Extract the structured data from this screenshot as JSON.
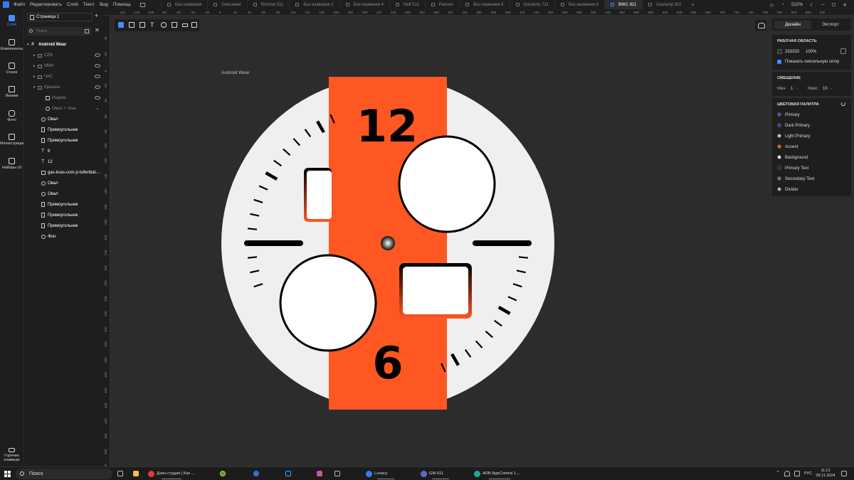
{
  "app": {
    "menu": [
      "Файл",
      "Редактировать",
      "Слой",
      "Текст",
      "Вид",
      "Помощь"
    ],
    "tabs": [
      {
        "label": "Без названия",
        "active": false
      },
      {
        "label": "Описание",
        "active": false
      },
      {
        "label": "Rimmel 311",
        "active": false
      },
      {
        "label": "Без названия 2",
        "active": false
      },
      {
        "label": "Без названия 4",
        "active": false
      },
      {
        "label": "Half 511",
        "active": false
      },
      {
        "label": "Pannex",
        "active": false
      },
      {
        "label": "Без названия 5",
        "active": false
      },
      {
        "label": "Gaslamp 711",
        "active": false
      },
      {
        "label": "Без названия 6",
        "active": false
      },
      {
        "label": "BWC 811",
        "active": true
      },
      {
        "label": "Gaslamp 911",
        "active": false
      }
    ],
    "zoom": "222%"
  },
  "rail": {
    "items": [
      {
        "label": "Слой",
        "icon": "layers-icon",
        "active": true
      },
      {
        "label": "Компоненты",
        "icon": "components-icon",
        "active": false
      },
      {
        "label": "Стили",
        "icon": "styles-icon",
        "active": false
      },
      {
        "label": "Иконки",
        "icon": "icons-icon",
        "active": false
      },
      {
        "label": "Фото",
        "icon": "photo-icon",
        "active": false
      },
      {
        "label": "Иллюстрации",
        "icon": "illustrations-icon",
        "active": false
      },
      {
        "label": "Наборы UI",
        "icon": "ui-kits-icon",
        "active": false
      }
    ],
    "hotkeys": "Горячие клавиши"
  },
  "layers": {
    "page": "Страница 1",
    "search_placeholder": "Поиск",
    "items": [
      {
        "label": "Android Wear",
        "kind": "board",
        "depth": 0,
        "dim": false,
        "bold": true
      },
      {
        "label": "СЕК",
        "kind": "group",
        "depth": 1,
        "dim": true
      },
      {
        "label": "МИН",
        "kind": "group",
        "depth": 1,
        "dim": true
      },
      {
        "label": "ЧАС",
        "kind": "group",
        "depth": 1,
        "dim": true
      },
      {
        "label": "Крышка",
        "kind": "group-open",
        "depth": 1,
        "dim": true
      },
      {
        "label": "Индекс",
        "kind": "image",
        "depth": 2,
        "dim": true
      },
      {
        "label": "Овал + тень",
        "kind": "oval",
        "depth": 2,
        "dim": true
      },
      {
        "label": "Овал",
        "kind": "oval",
        "depth": 1,
        "dim": false
      },
      {
        "label": "Прямоугольник",
        "kind": "rect",
        "depth": 1,
        "dim": false
      },
      {
        "label": "Прямоугольник",
        "kind": "rect",
        "depth": 1,
        "dim": false
      },
      {
        "label": "6",
        "kind": "text",
        "depth": 1,
        "dim": false
      },
      {
        "label": "12",
        "kind": "text",
        "depth": 1,
        "dim": false
      },
      {
        "label": "gas-kvas-com-p-tsiferblat-...",
        "kind": "image",
        "depth": 1,
        "dim": false
      },
      {
        "label": "Овал",
        "kind": "oval",
        "depth": 1,
        "dim": false
      },
      {
        "label": "Овал",
        "kind": "oval",
        "depth": 1,
        "dim": false
      },
      {
        "label": "Прямоугольник",
        "kind": "rect",
        "depth": 1,
        "dim": false
      },
      {
        "label": "Прямоугольник",
        "kind": "rect",
        "depth": 1,
        "dim": false
      },
      {
        "label": "Прямоугольник",
        "kind": "rect",
        "depth": 1,
        "dim": false
      },
      {
        "label": "Фон",
        "kind": "oval",
        "depth": 1,
        "dim": false
      }
    ]
  },
  "rulers": {
    "h": [
      "-140",
      "-120",
      "-100",
      "-80",
      "-60",
      "-40",
      "-20",
      "0",
      "20",
      "40",
      "60",
      "80",
      "100",
      "120",
      "140",
      "160",
      "180",
      "200",
      "220",
      "240",
      "260",
      "280",
      "300",
      "320",
      "340",
      "360",
      "380",
      "400",
      "420",
      "440",
      "460",
      "480",
      "500",
      "520",
      "540",
      "560",
      "580",
      "600",
      "620",
      "640",
      "660",
      "680",
      "700",
      "720",
      "740",
      "760",
      "780",
      "800",
      "820",
      "840"
    ],
    "v": [
      "-40",
      "-20",
      "0",
      "20",
      "40",
      "60",
      "80",
      "100",
      "120",
      "140",
      "160",
      "180",
      "200",
      "220",
      "240",
      "260",
      "280",
      "300",
      "320",
      "340",
      "360",
      "380",
      "400",
      "420",
      "440",
      "460",
      "480",
      "500",
      "520"
    ]
  },
  "canvas": {
    "board_label": "Android Wear",
    "numerals": {
      "twelve": "12",
      "six": "6"
    },
    "colors": {
      "face": "#efefef",
      "strip": "#ff5722",
      "ink": "#000000",
      "canvas": "#2c2c2c"
    }
  },
  "inspector": {
    "tabs": {
      "design": "Дизайн",
      "export": "Экспорт"
    },
    "artboard": {
      "title": "РАБОЧАЯ ОБЛАСТЬ",
      "color": "333333",
      "opacity": "100%",
      "pixel_grid_label": "Показать пиксельную сетку",
      "pixel_grid_checked": true
    },
    "offset": {
      "title": "СМЕЩЕНИЕ",
      "min_label": "Мин",
      "min_value": "1",
      "max_label": "Макс",
      "max_value": "10"
    },
    "palette": {
      "title": "ЦВЕТОВАЯ ПАЛИТРА",
      "items": [
        {
          "label": "Primary",
          "color": "#3f51b5"
        },
        {
          "label": "Dark Primary",
          "color": "#303f9f"
        },
        {
          "label": "Light Primary",
          "color": "#c5cae9"
        },
        {
          "label": "Accent",
          "color": "#ff5722"
        },
        {
          "label": "Background",
          "color": "#ffffff"
        },
        {
          "label": "Primary Text",
          "color": "#212121"
        },
        {
          "label": "Secondary Text",
          "color": "#757575"
        },
        {
          "label": "Divider",
          "color": "#bdbdbd"
        }
      ]
    }
  },
  "taskbar": {
    "search": "Поиск",
    "tasks": [
      {
        "label": "Дзен-студия | Как ...",
        "color": "#e53935"
      },
      {
        "label": "Lunacy",
        "color": "#2f80ed"
      },
      {
        "label": "GM 611",
        "color": "#5c6bc0"
      },
      {
        "label": "ADB AppControl 1....",
        "color": "#26a69a"
      }
    ],
    "lang": "РУС",
    "time": "11:21",
    "date": "09.11.2024"
  }
}
